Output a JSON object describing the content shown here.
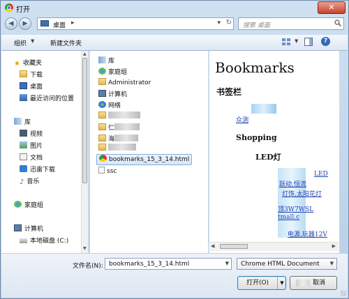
{
  "window": {
    "title": "打开",
    "close_glyph": "✕"
  },
  "nav": {
    "back_glyph": "◀",
    "forward_glyph": "▶",
    "address": "桌面",
    "address_sep": "▸",
    "address_dropdown": "▾",
    "refresh_glyph": "↻",
    "search_placeholder": "搜索 桌面"
  },
  "toolbar": {
    "organize": "组织",
    "organize_dd": "▼",
    "new_folder": "新建文件夹",
    "view_dd": "▼",
    "help": "?"
  },
  "sidebar": {
    "items": [
      {
        "label": "收藏夹",
        "icon": "star-icon"
      },
      {
        "label": "下载",
        "icon": "download-folder-icon"
      },
      {
        "label": "桌面",
        "icon": "desktop-icon"
      },
      {
        "label": "最近访问的位置",
        "icon": "recent-places-icon"
      },
      {
        "label": "库",
        "icon": "library-icon"
      },
      {
        "label": "视频",
        "icon": "video-icon"
      },
      {
        "label": "图片",
        "icon": "pictures-icon"
      },
      {
        "label": "文档",
        "icon": "documents-icon"
      },
      {
        "label": "迅雷下载",
        "icon": "thunder-download-icon"
      },
      {
        "label": "音乐",
        "icon": "music-icon"
      },
      {
        "label": "家庭组",
        "icon": "homegroup-icon"
      },
      {
        "label": "计算机",
        "icon": "computer-icon"
      },
      {
        "label": "本地磁盘 (C:)",
        "icon": "drive-icon"
      }
    ],
    "scroll_up": "▲",
    "scroll_down": "▼"
  },
  "files": {
    "items": [
      {
        "label": "库",
        "icon": "library-icon"
      },
      {
        "label": "家庭组",
        "icon": "homegroup-icon"
      },
      {
        "label": "Administrator",
        "icon": "user-folder-icon"
      },
      {
        "label": "计算机",
        "icon": "computer-icon"
      },
      {
        "label": "网络",
        "icon": "network-icon"
      },
      {
        "label": "",
        "icon": "folder-icon"
      },
      {
        "label": "仁",
        "icon": "folder-icon"
      },
      {
        "label": "海",
        "icon": "folder-icon"
      },
      {
        "label": "",
        "icon": "folder-icon"
      },
      {
        "label": "bookmarks_15_3_14.html",
        "icon": "chrome-html-icon"
      },
      {
        "label": "ssc",
        "icon": "file-icon"
      }
    ]
  },
  "preview": {
    "title": "Bookmarks",
    "heading": "书签栏",
    "link1": "众测",
    "item2": "Shopping",
    "item3": "LED灯",
    "link_lines": [
      "LED",
      "跃动,恒流",
      "灯饰,太阳花灯",
      "顶3W7WSL",
      "tmall.c",
      "电源,玩器12V"
    ],
    "scroll_left": "◀",
    "scroll_right": "▶"
  },
  "footer": {
    "filename_label": "文件名(N):",
    "filename_value": "bookmarks_15_3_14.html",
    "filename_dd": "▼",
    "filetype": "Chrome HTML Document",
    "filetype_dd": "▼",
    "open_label": "打开(O)",
    "open_dd": "▼",
    "cancel_label": "取消"
  }
}
